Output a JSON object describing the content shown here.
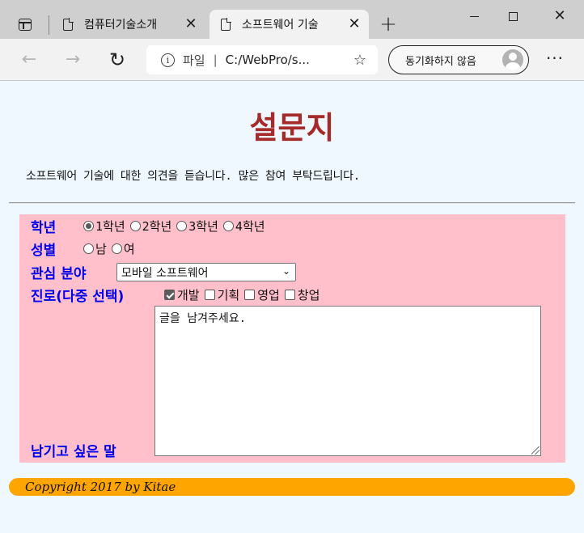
{
  "browser": {
    "tabs": [
      {
        "title": "컴퓨터기술소개"
      },
      {
        "title": "소프트웨어 기술"
      }
    ],
    "omnibox": {
      "scheme": "파일",
      "separator": "|",
      "url": "C:/WebPro/s..."
    },
    "sync_label": "동기화하지 않음"
  },
  "page": {
    "title": "설문지",
    "intro": "소프트웨어 기술에 대한 의견을 듣습니다. 많은 참여 부탁드립니다.",
    "form": {
      "grade": {
        "label": "학년",
        "options": [
          "1학년",
          "2학년",
          "3학년",
          "4학년"
        ],
        "selected": "1학년"
      },
      "gender": {
        "label": "성별",
        "options": [
          "남",
          "여"
        ]
      },
      "interest": {
        "label": "관심 분야",
        "selected": "모바일 소프트웨어"
      },
      "career": {
        "label": "진로(다중 선택)",
        "options": [
          "개발",
          "기획",
          "영업",
          "창업"
        ],
        "checked": [
          "개발"
        ]
      },
      "comment": {
        "label": "남기고 싶은 말",
        "value": "글을 남겨주세요."
      }
    },
    "footer": "Copyright 2017 by Kitae"
  },
  "colors": {
    "title": "#a52a2a",
    "label": "#0000ee",
    "form_bg": "#ffc0cb",
    "footer_bg": "#ffa500",
    "page_bg": "#f0f8ff"
  }
}
